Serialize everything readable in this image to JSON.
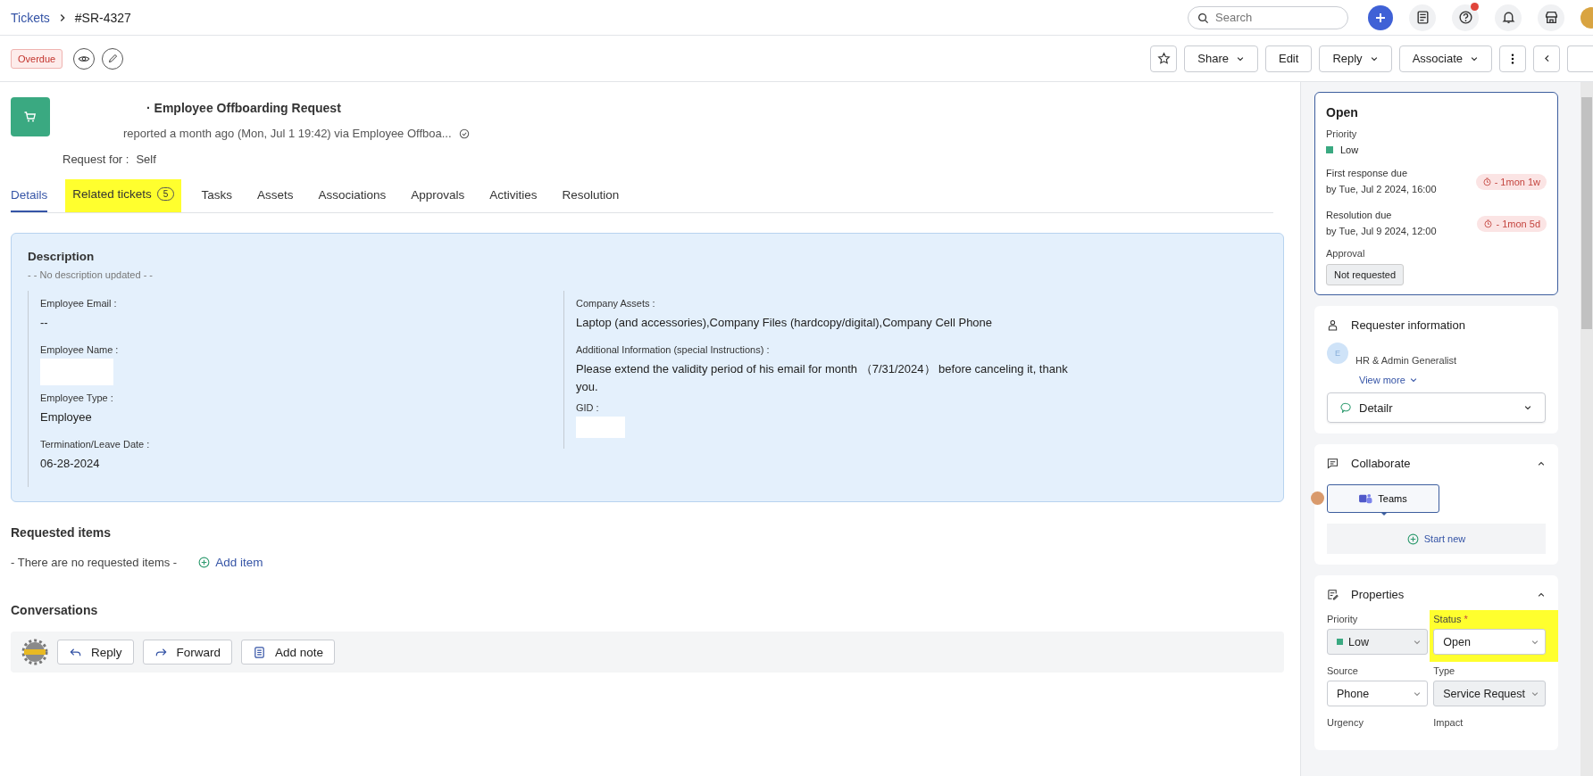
{
  "breadcrumb": {
    "parent": "Tickets",
    "current": "#SR-4327"
  },
  "search": {
    "placeholder": "Search"
  },
  "status_tag": "Overdue",
  "toolbar_buttons": [
    {
      "label": "Share",
      "kind": "dropdown"
    },
    {
      "label": "Edit",
      "kind": "plain"
    },
    {
      "label": "Reply",
      "kind": "dropdown"
    },
    {
      "label": "Associate",
      "kind": "dropdown"
    }
  ],
  "ticket": {
    "title": "· Employee Offboarding Request",
    "meta": "reported a month ago (Mon, Jul 1 19:42) via Employee Offboa...",
    "request_for_label": "Request for :",
    "request_for_value": "Self"
  },
  "tabs": [
    {
      "label": "Details",
      "selected": true,
      "highlighted": false
    },
    {
      "label": "Related tickets",
      "count": "5",
      "selected": false,
      "highlighted": true
    },
    {
      "label": "Tasks",
      "selected": false,
      "highlighted": false
    },
    {
      "label": "Assets",
      "selected": false,
      "highlighted": false
    },
    {
      "label": "Associations",
      "selected": false,
      "highlighted": false
    },
    {
      "label": "Approvals",
      "selected": false,
      "highlighted": false
    },
    {
      "label": "Activities",
      "selected": false,
      "highlighted": false
    },
    {
      "label": "Resolution",
      "selected": false,
      "highlighted": false
    }
  ],
  "description": {
    "title": "Description",
    "note": "- - No description updated - -",
    "fields_left": [
      {
        "label": "Employee Email :",
        "value": "--",
        "redacted": false
      },
      {
        "label": "Employee Name :",
        "redacted": true
      },
      {
        "label": "Employee Type :",
        "value": "Employee",
        "redacted": false
      },
      {
        "label": "Termination/Leave Date :",
        "value": "06-28-2024",
        "redacted": false
      }
    ],
    "fields_right": [
      {
        "label": "Company Assets :",
        "value": "Laptop (and accessories),Company Files (hardcopy/digital),Company Cell Phone",
        "redacted": false
      },
      {
        "label": "Additional Information (special Instructions) :",
        "value": "Please extend the validity period of his email for month （7/31/2024） before canceling it, thank you.",
        "redacted": false
      },
      {
        "label": "GID :",
        "redacted": true
      }
    ]
  },
  "requested_items": {
    "title": "Requested items",
    "empty": "- There are no requested items -",
    "add_label": "Add item"
  },
  "conversations": {
    "title": "Conversations",
    "actions": [
      {
        "label": "Reply",
        "kind": "reply"
      },
      {
        "label": "Forward",
        "kind": "forward"
      },
      {
        "label": "Add note",
        "kind": "note"
      }
    ]
  },
  "summary": {
    "status": "Open",
    "priority_label": "Priority",
    "priority": {
      "label": "Low",
      "color": "#3aa981"
    },
    "due": [
      {
        "label": "First response due",
        "date": "by Tue, Jul 2 2024, 16:00",
        "overdue": "- 1mon 1w"
      },
      {
        "label": "Resolution due",
        "date": "by Tue, Jul 9 2024, 12:00",
        "overdue": "- 1mon 5d"
      }
    ],
    "approval_label": "Approval",
    "approval": "Not requested"
  },
  "requester": {
    "title": "Requester information",
    "avatar": "E",
    "role": "HR & Admin Generalist",
    "view_more": "View more",
    "select": "Detailr"
  },
  "collaborate": {
    "title": "Collaborate",
    "teams": "Teams",
    "start_new": "Start new"
  },
  "properties": {
    "title": "Properties",
    "fields": [
      {
        "label": "Priority",
        "value": "Low",
        "color": "#3aa981",
        "disabled": true,
        "highlighted": false
      },
      {
        "label": "Status",
        "required_mark": "*",
        "value": "Open",
        "disabled": false,
        "highlighted": true
      },
      {
        "label": "Source",
        "value": "Phone",
        "disabled": false,
        "highlighted": false
      },
      {
        "label": "Type",
        "value": "Service Request",
        "disabled": true,
        "highlighted": false
      }
    ],
    "more_labels": [
      "Urgency",
      "Impact"
    ]
  }
}
